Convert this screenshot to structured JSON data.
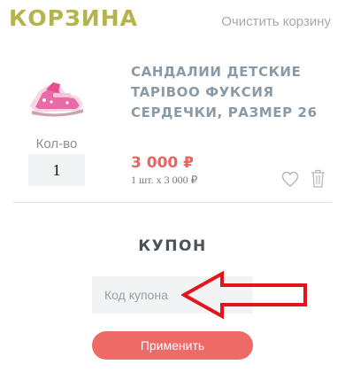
{
  "header": {
    "title": "КОРЗИНА",
    "clear_label": "Очистить корзину"
  },
  "cart_item": {
    "name": "САНДАЛИИ ДЕТСКИЕ TAPIBOO ФУКСИЯ СЕРДЕЧКИ, РАЗМЕР 26",
    "qty_label": "Кол-во",
    "qty_value": "1",
    "price": "3 000 ₽",
    "price_detail": "1 шт. x 3 000 ₽",
    "favorite_icon": "heart-icon",
    "delete_icon": "trash-icon"
  },
  "coupon": {
    "heading": "КУПОН",
    "placeholder": "Код купона",
    "apply_label": "Применить"
  },
  "colors": {
    "title": "#b3b450",
    "price": "#e9645f",
    "button": "#ee6a66",
    "arrow": "#e0161c"
  }
}
